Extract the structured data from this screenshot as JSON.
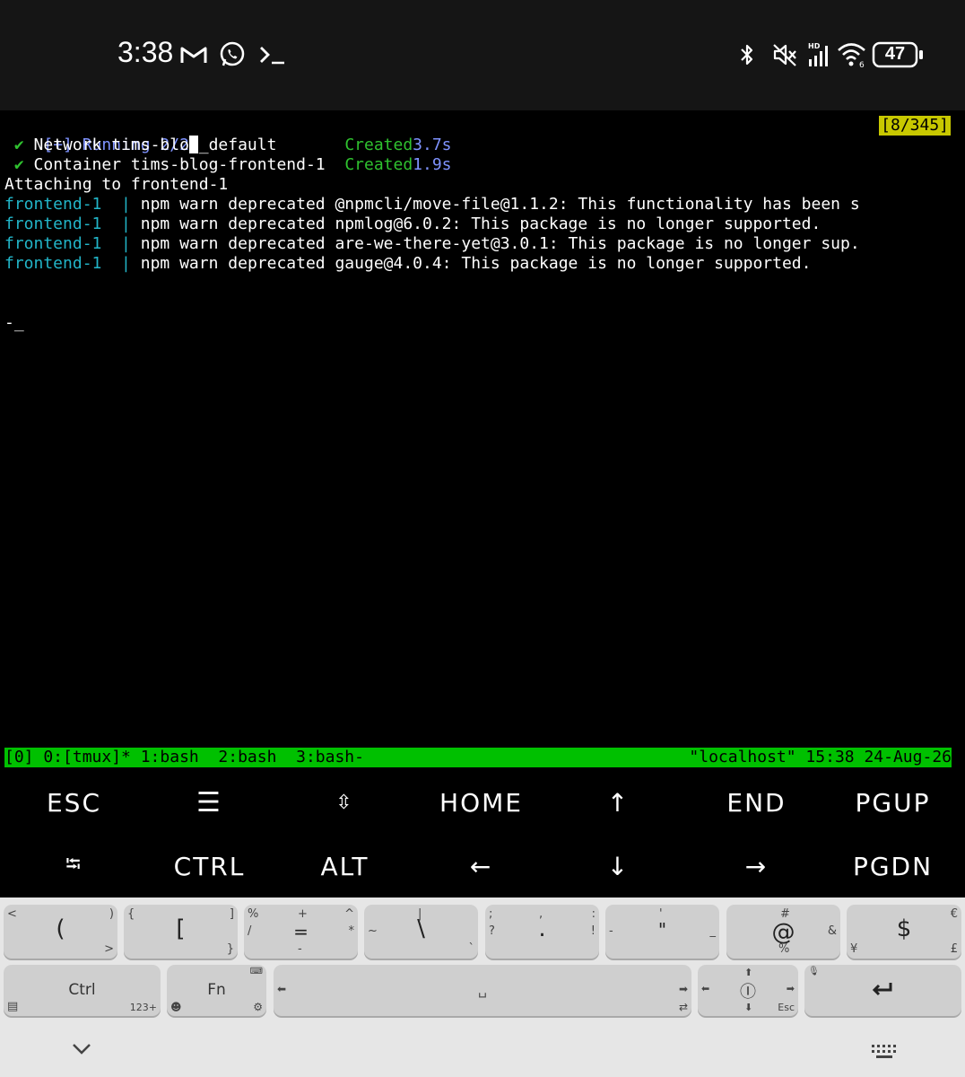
{
  "status_bar": {
    "time": "3:38",
    "battery": "47",
    "icons": [
      "gmail-icon",
      "whatsapp-icon",
      "terminal-icon",
      "bluetooth-icon",
      "mute-icon",
      "signal-icon",
      "wifi-icon",
      "battery-icon"
    ],
    "signal_badge": "HD",
    "wifi_badge": "6"
  },
  "terminal": {
    "pane_position": "[8/345]",
    "running": "[+] Running 2/2",
    "rows": [
      {
        "check": "✔",
        "text": " Network tims-blog_default       ",
        "status": "Created",
        "time": "3.7s"
      },
      {
        "check": "✔",
        "text": " Container tims-blog-frontend-1  ",
        "status": "Created",
        "time": "1.9s"
      }
    ],
    "attaching": "Attaching to frontend-1",
    "logs": [
      {
        "service": "frontend-1  ",
        "sep": "| ",
        "msg": "npm warn deprecated @npmcli/move-file@1.1.2: This functionality has been s"
      },
      {
        "service": "frontend-1  ",
        "sep": "| ",
        "msg": "npm warn deprecated npmlog@6.0.2: This package is no longer supported."
      },
      {
        "service": "frontend-1  ",
        "sep": "| ",
        "msg": "npm warn deprecated are-we-there-yet@3.0.1: This package is no longer sup."
      },
      {
        "service": "frontend-1  ",
        "sep": "| ",
        "msg": "npm warn deprecated gauge@4.0.4: This package is no longer supported."
      }
    ],
    "prompt": "-_"
  },
  "tmux": {
    "left": "[0] 0:[tmux]* 1:bash  2:bash  3:bash-",
    "right": "\"localhost\" 15:38 24-Aug-26"
  },
  "extra_keys": {
    "row1": [
      "ESC",
      "☰",
      "⇳",
      "HOME",
      "↑",
      "END",
      "PGUP"
    ],
    "row2": [
      "⭾",
      "CTRL",
      "ALT",
      "←",
      "↓",
      "→",
      "PGDN"
    ]
  },
  "keyboard": {
    "symbol_row": [
      {
        "main": "(",
        "tl": "<",
        "tr": ")",
        "bl": "",
        "br": ">"
      },
      {
        "main": "[",
        "tl": "{",
        "tr": "]",
        "bl": "",
        "br": "}"
      },
      {
        "main": "=",
        "tl": "%",
        "tr": "^",
        "bl": "/",
        "br": "*",
        "top": "+",
        "bottom": "-"
      },
      {
        "main": "\\",
        "tl": "",
        "tr": "",
        "bl": "~",
        "br": "`",
        "top": "|"
      },
      {
        "main": ".",
        "tl": ";",
        "tr": ":",
        "bl": "?",
        "br": "!",
        "top": ","
      },
      {
        "main": "\"",
        "tl": "",
        "tr": "",
        "bl": "-",
        "br": "_",
        "top": "'"
      },
      {
        "main": "@",
        "tl": "",
        "tr": "",
        "bl": "",
        "br": "&",
        "top": "#",
        "bottom": "%"
      },
      {
        "main": "$",
        "tl": "",
        "tr": "€",
        "bl": "¥",
        "br": "£"
      }
    ],
    "ctrl_label": "Ctrl",
    "ctrl_sub": "123+",
    "fn_label": "Fn",
    "space_symbol": "␣",
    "esc_label": "Esc"
  }
}
